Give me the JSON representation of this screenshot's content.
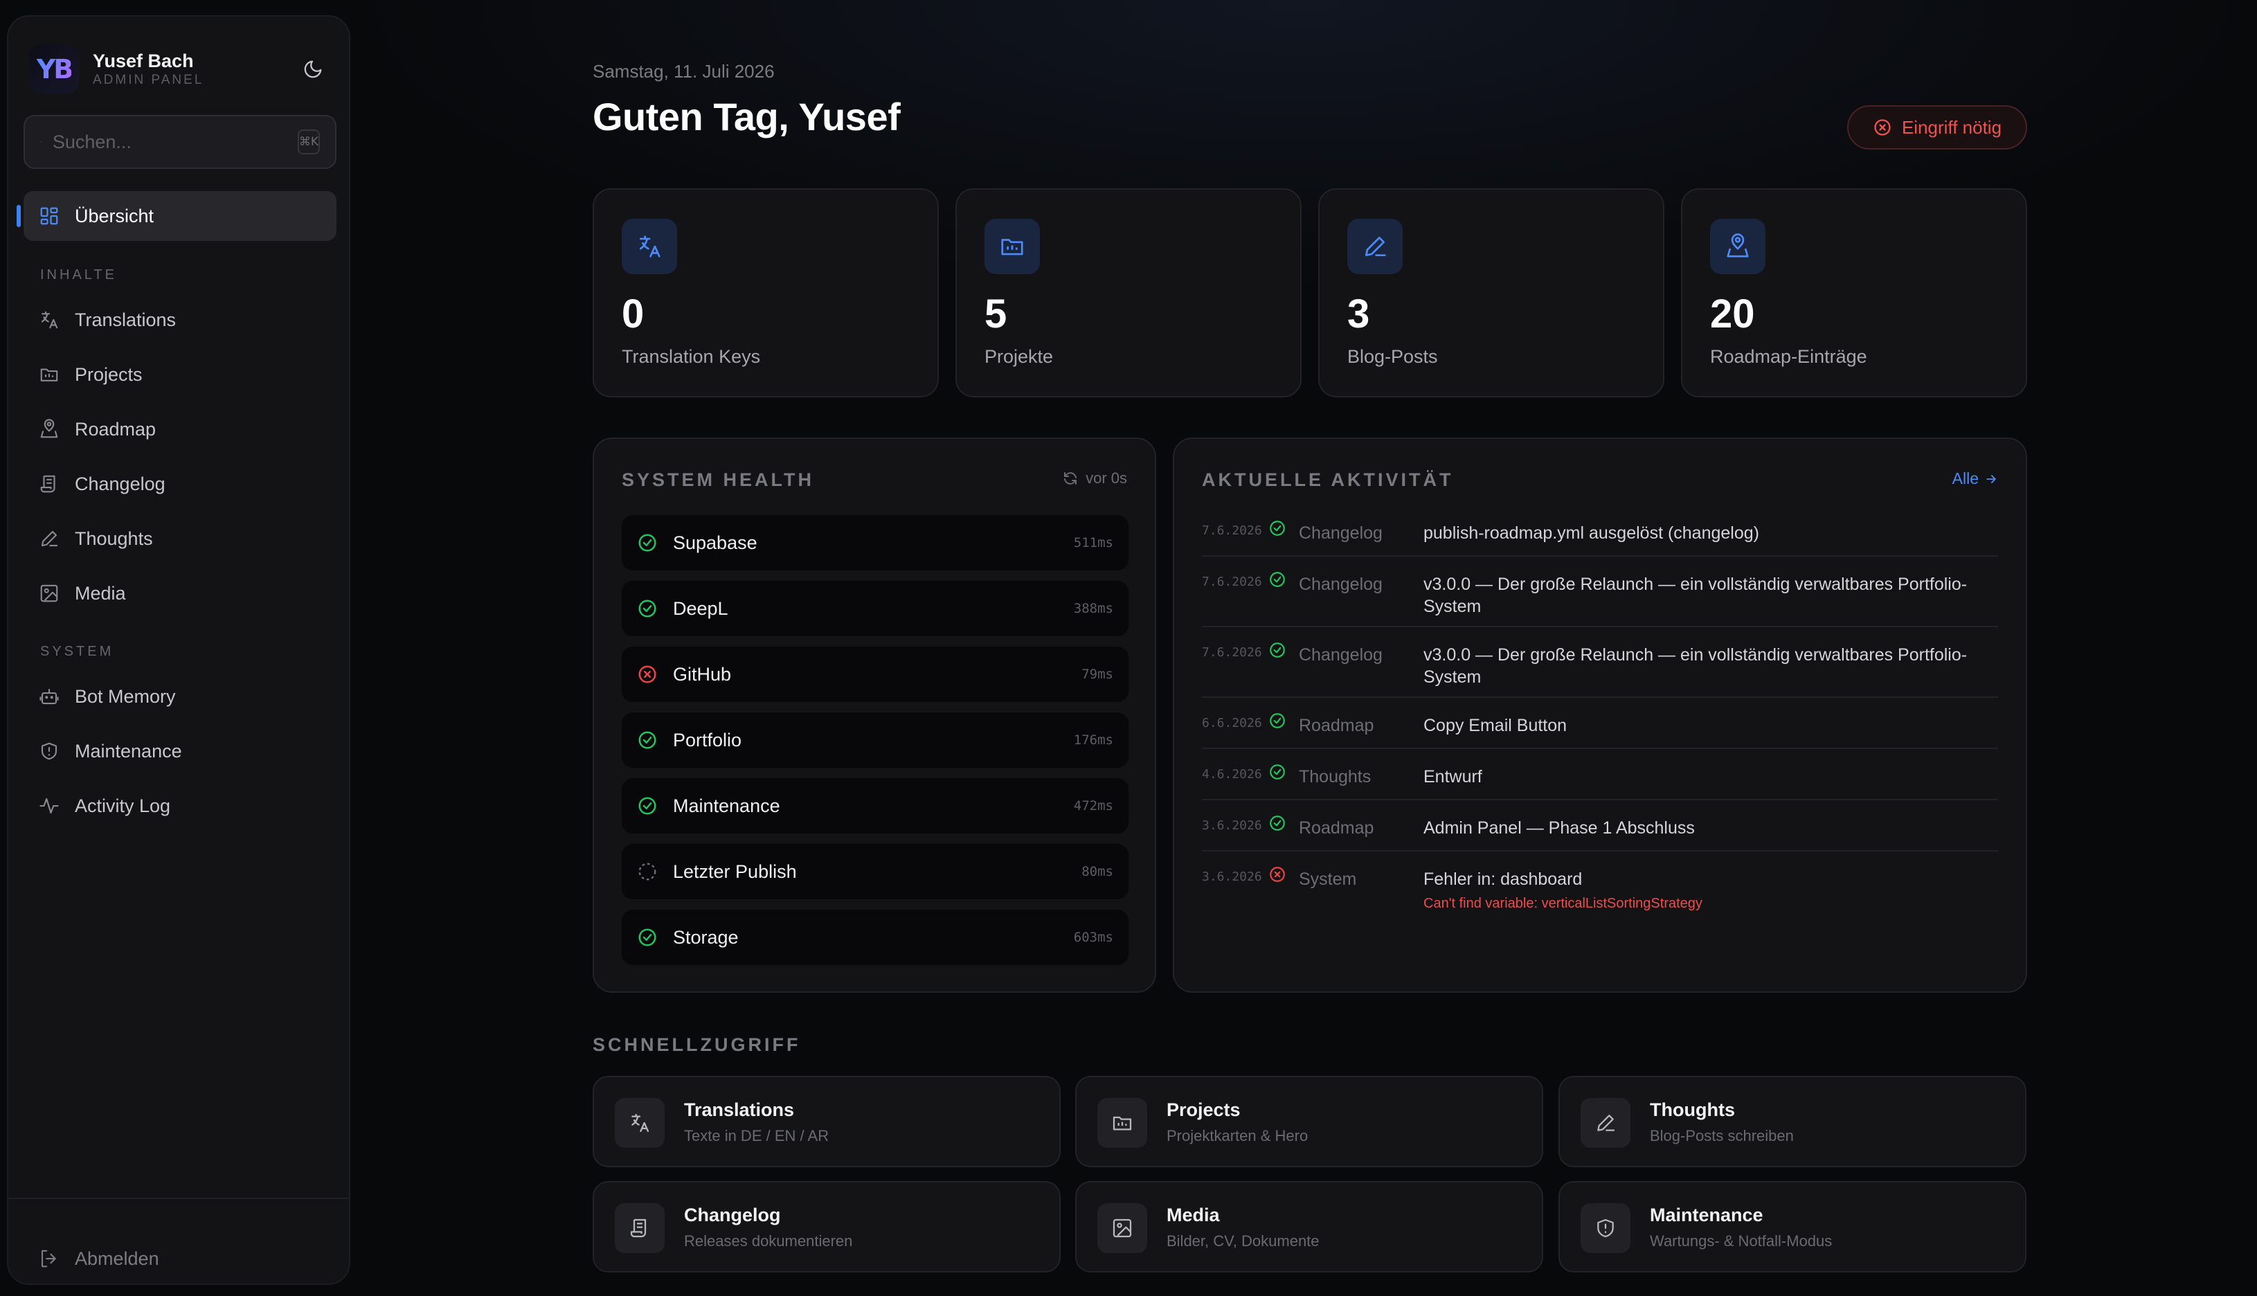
{
  "profile": {
    "initials": "YB",
    "name": "Yusef Bach",
    "role": "ADMIN PANEL"
  },
  "search": {
    "placeholder": "Suchen...",
    "shortcut": "⌘K"
  },
  "nav": {
    "overview": "Übersicht",
    "section_content": "INHALTE",
    "content_items": [
      "Translations",
      "Projects",
      "Roadmap",
      "Changelog",
      "Thoughts",
      "Media"
    ],
    "section_system": "SYSTEM",
    "system_items": [
      "Bot Memory",
      "Maintenance",
      "Activity Log"
    ],
    "logout": "Abmelden"
  },
  "header": {
    "date": "Samstag, 11. Juli 2026",
    "greeting": "Guten Tag, Yusef",
    "alert": "Eingriff nötig"
  },
  "stats": [
    {
      "value": "0",
      "label": "Translation Keys",
      "icon": "translate-icon"
    },
    {
      "value": "5",
      "label": "Projekte",
      "icon": "folder-icon"
    },
    {
      "value": "3",
      "label": "Blog-Posts",
      "icon": "pen-icon"
    },
    {
      "value": "20",
      "label": "Roadmap-Einträge",
      "icon": "map-pin-icon"
    }
  ],
  "health": {
    "title": "SYSTEM HEALTH",
    "refreshed": "vor 0s",
    "services": [
      {
        "name": "Supabase",
        "ms": "511ms",
        "status": "ok"
      },
      {
        "name": "DeepL",
        "ms": "388ms",
        "status": "ok"
      },
      {
        "name": "GitHub",
        "ms": "79ms",
        "status": "error"
      },
      {
        "name": "Portfolio",
        "ms": "176ms",
        "status": "ok"
      },
      {
        "name": "Maintenance",
        "ms": "472ms",
        "status": "ok"
      },
      {
        "name": "Letzter Publish",
        "ms": "80ms",
        "status": "pending"
      },
      {
        "name": "Storage",
        "ms": "603ms",
        "status": "ok"
      }
    ]
  },
  "activity": {
    "title": "AKTUELLE AKTIVITÄT",
    "all_link": "Alle",
    "items": [
      {
        "date": "7.6.2026",
        "category": "Changelog",
        "text": "publish-roadmap.yml ausgelöst (changelog)",
        "status": "ok"
      },
      {
        "date": "7.6.2026",
        "category": "Changelog",
        "text": "v3.0.0 — Der große Relaunch — ein vollständig verwaltbares Portfolio-System",
        "status": "ok"
      },
      {
        "date": "7.6.2026",
        "category": "Changelog",
        "text": "v3.0.0 — Der große Relaunch — ein vollständig verwaltbares Portfolio-System",
        "status": "ok"
      },
      {
        "date": "6.6.2026",
        "category": "Roadmap",
        "text": "Copy Email Button",
        "status": "ok"
      },
      {
        "date": "4.6.2026",
        "category": "Thoughts",
        "text": "Entwurf",
        "status": "ok"
      },
      {
        "date": "3.6.2026",
        "category": "Roadmap",
        "text": "Admin Panel — Phase 1 Abschluss",
        "status": "ok"
      },
      {
        "date": "3.6.2026",
        "category": "System",
        "text": "Fehler in: dashboard",
        "error": "Can't find variable: verticalListSortingStrategy",
        "status": "error"
      }
    ]
  },
  "quick": {
    "title": "SCHNELLZUGRIFF",
    "cards": [
      {
        "name": "Translations",
        "sub": "Texte in DE / EN / AR"
      },
      {
        "name": "Projects",
        "sub": "Projektkarten & Hero"
      },
      {
        "name": "Thoughts",
        "sub": "Blog-Posts schreiben"
      },
      {
        "name": "Changelog",
        "sub": "Releases dokumentieren"
      },
      {
        "name": "Media",
        "sub": "Bilder, CV, Dokumente"
      },
      {
        "name": "Maintenance",
        "sub": "Wartungs- & Notfall-Modus"
      }
    ]
  },
  "colors": {
    "accent": "#3b82f6",
    "ok": "#22c55e",
    "error": "#ef4444",
    "bg": "#08090b",
    "card": "#131316"
  }
}
